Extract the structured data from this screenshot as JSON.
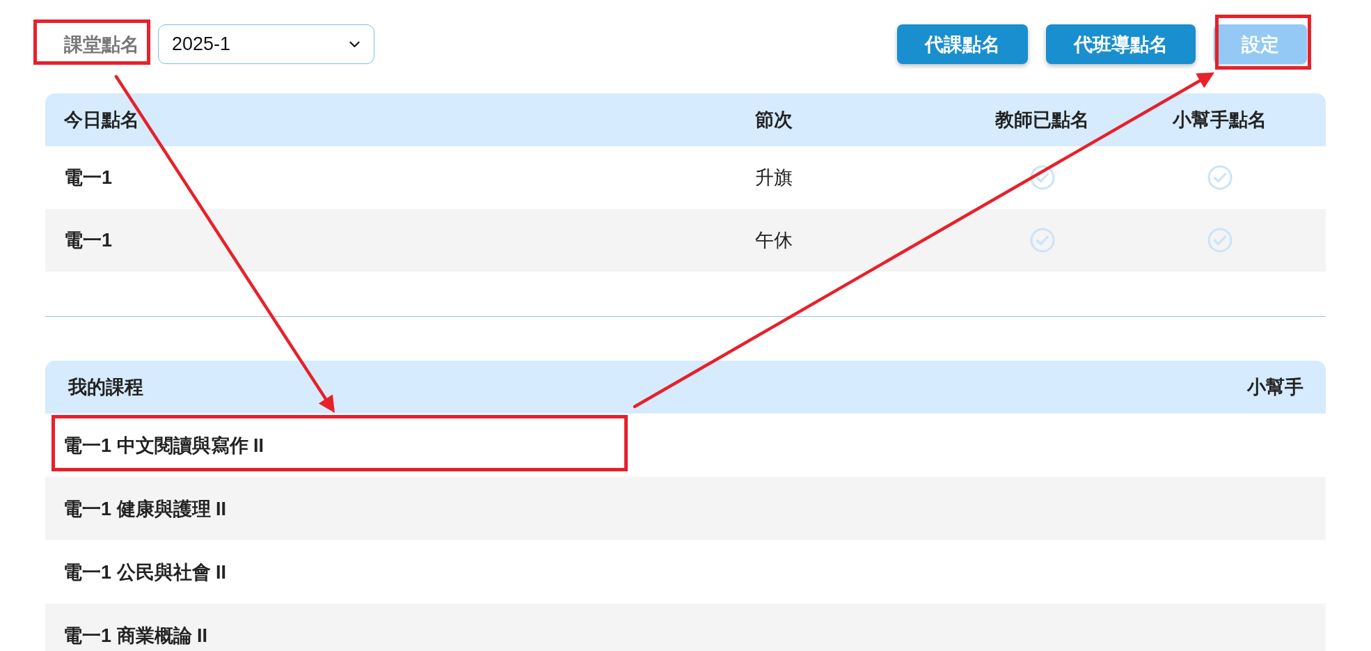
{
  "toolbar": {
    "title": {
      "text": "課堂點名",
      "highlighted": true
    },
    "term_select": {
      "value": "2025-1"
    },
    "buttons": [
      {
        "label": "代課點名",
        "disabled": false,
        "highlighted": false
      },
      {
        "label": "代班導點名",
        "disabled": false,
        "highlighted": false
      },
      {
        "label": "設定",
        "disabled": true,
        "highlighted": true
      }
    ]
  },
  "attendance_table": {
    "columns": [
      "今日點名",
      "節次",
      "教師已點名",
      "小幫手點名"
    ],
    "rows": [
      {
        "class": "電一1",
        "period": "升旗",
        "teacher_checked": false,
        "helper_checked": false
      },
      {
        "class": "電一1",
        "period": "午休",
        "teacher_checked": false,
        "helper_checked": false
      }
    ]
  },
  "course_table": {
    "columns": [
      "我的課程",
      "小幫手"
    ],
    "rows": [
      {
        "name": "電一1 中文閱讀與寫作 II",
        "highlighted": true
      },
      {
        "name": "電一1 健康與護理 II",
        "highlighted": false
      },
      {
        "name": "電一1 公民與社會 II",
        "highlighted": false
      },
      {
        "name": "電一1 商業概論 II",
        "highlighted": false
      }
    ]
  }
}
